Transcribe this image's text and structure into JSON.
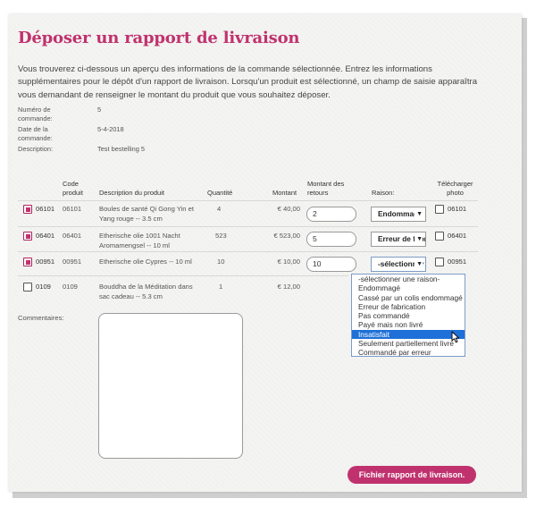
{
  "page": {
    "title": "Déposer un rapport de livraison",
    "intro": "Vous trouverez ci-dessous un aperçu des informations de la commande sélectionnée. Entrez les informations supplémentaires pour le dépôt d'un rapport de livraison. Lorsqu'un produit est sélectionné, un champ de saisie apparaîtra vous demandant de renseigner le montant du produit que vous souhaitez déposer."
  },
  "order": {
    "number_label": "Numéro de commande:",
    "number_value": "5",
    "date_label": "Date de la commande:",
    "date_value": "5-4-2018",
    "description_label": "Description:",
    "description_value": "Test bestelling 5"
  },
  "table": {
    "headers": {
      "code": "Code produit",
      "description": "Description du produit",
      "quantity": "Quantité",
      "amount": "Montant",
      "return_amount": "Montant des retours",
      "reason": "Raison:",
      "download": "Télécharger photo"
    },
    "rows": [
      {
        "checked": true,
        "code_check": "06101",
        "code": "06101",
        "description": "Boules de santé Qi Gong Yin et Yang rouge -- 3.5 cm",
        "quantity": "4",
        "amount": "€ 40,00",
        "return_amount": "2",
        "reason": "Endommagé",
        "photo_checked": false,
        "photo_code": "06101"
      },
      {
        "checked": true,
        "code_check": "06401",
        "code": "06401",
        "description": "Etherische olie 1001 Nacht Aromamengsel -- 10 ml",
        "quantity": "523",
        "amount": "€ 523,00",
        "return_amount": "5",
        "reason": "Erreur de fabrication",
        "photo_checked": false,
        "photo_code": "06401"
      },
      {
        "checked": true,
        "code_check": "00951",
        "code": "00951",
        "description": "Etherische olie Cypres -- 10 ml",
        "quantity": "10",
        "amount": "€ 10,00",
        "return_amount": "10",
        "reason": "-sélectionner une raison-",
        "photo_checked": false,
        "photo_code": "00951"
      },
      {
        "checked": false,
        "code_check": "0109",
        "code": "0109",
        "description": "Bouddha de la Méditation dans sac cadeau -- 5.3 cm",
        "quantity": "1",
        "amount": "€ 12,00"
      }
    ]
  },
  "dropdown": {
    "options": [
      "-sélectionner une raison-",
      "Endommagé",
      "Cassé par un colis endommagé",
      "Erreur de fabrication",
      "Pas commandé",
      "Payé mais non livré",
      "Insatisfait",
      "Seulement partiellement livré",
      "Commandé par erreur"
    ],
    "highlighted": "Insatisfait"
  },
  "comments": {
    "label": "Commentaires:",
    "value": ""
  },
  "submit": {
    "label": "Fichier rapport de livraison."
  },
  "colors": {
    "accent": "#c0326e",
    "highlight": "#1e6fd8"
  }
}
